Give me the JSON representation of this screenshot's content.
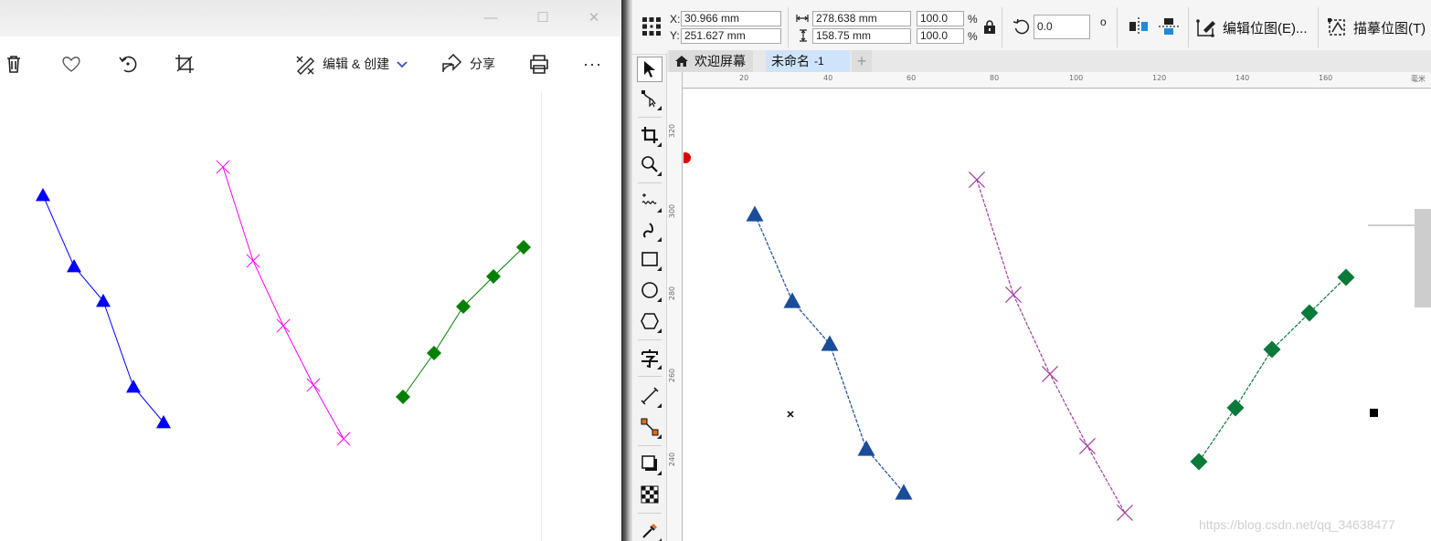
{
  "viewer": {
    "window_controls": {
      "minimize": "—",
      "maximize": "☐",
      "close": "✕"
    },
    "toolbar": {
      "edit_create_label": "编辑 & 创建",
      "share_label": "分享",
      "more_label": "···"
    },
    "figure": {
      "series": [
        {
          "marker": "triangle",
          "color": "#0000ff",
          "points": [
            [
              47,
              214
            ],
            [
              81,
              292
            ],
            [
              113,
              330
            ],
            [
              146,
              424
            ],
            [
              179,
              463
            ]
          ]
        },
        {
          "marker": "x",
          "color": "#ff00ff",
          "points": [
            [
              244,
              183
            ],
            [
              277,
              286
            ],
            [
              310,
              357
            ],
            [
              343,
              422
            ],
            [
              376,
              481
            ]
          ]
        },
        {
          "marker": "diamond",
          "color": "#008000",
          "points": [
            [
              441,
              435
            ],
            [
              475,
              387
            ],
            [
              507,
              336
            ],
            [
              540,
              303
            ],
            [
              573,
              271
            ]
          ]
        }
      ]
    }
  },
  "corel": {
    "props": {
      "x_label": "X:",
      "x_value": "30.966 mm",
      "y_label": "Y:",
      "y_value": "251.627 mm",
      "width_value": "278.638 mm",
      "height_value": "158.75 mm",
      "scale_w": "100.0",
      "scale_h": "100.0",
      "pct_w": "%",
      "pct_h": "%",
      "rotation": "0.0",
      "degree_symbol": "o",
      "edit_bitmap_label": "编辑位图(E)...",
      "trace_bitmap_label": "描摹位图(T)"
    },
    "tabs": {
      "welcome": "欢迎屏幕",
      "document": "未命名",
      "document_suffix": "-1",
      "add": "+"
    },
    "rulers": {
      "h_ticks": [
        "20",
        "40",
        "60",
        "80",
        "100",
        "120",
        "140",
        "160"
      ],
      "h_unit": "毫米",
      "v_ticks": [
        "320",
        "300",
        "280",
        "260",
        "240"
      ]
    },
    "drawing": {
      "series": [
        {
          "marker": "triangle",
          "color": "#1a4d99",
          "points": [
            [
              826,
              235
            ],
            [
              867,
              330
            ],
            [
              908,
              377
            ],
            [
              948,
              492
            ],
            [
              989,
              540
            ]
          ]
        },
        {
          "marker": "x",
          "color": "#a040a0",
          "points": [
            [
              1069,
              197
            ],
            [
              1109,
              323
            ],
            [
              1149,
              410
            ],
            [
              1190,
              489
            ],
            [
              1231,
              562
            ]
          ]
        },
        {
          "marker": "diamond",
          "color": "#0a7a3a",
          "points": [
            [
              1312,
              506
            ],
            [
              1352,
              447
            ],
            [
              1392,
              383
            ],
            [
              1433,
              343
            ],
            [
              1473,
              304
            ]
          ]
        }
      ]
    },
    "watermark": "https://blog.csdn.net/qq_34638477"
  }
}
